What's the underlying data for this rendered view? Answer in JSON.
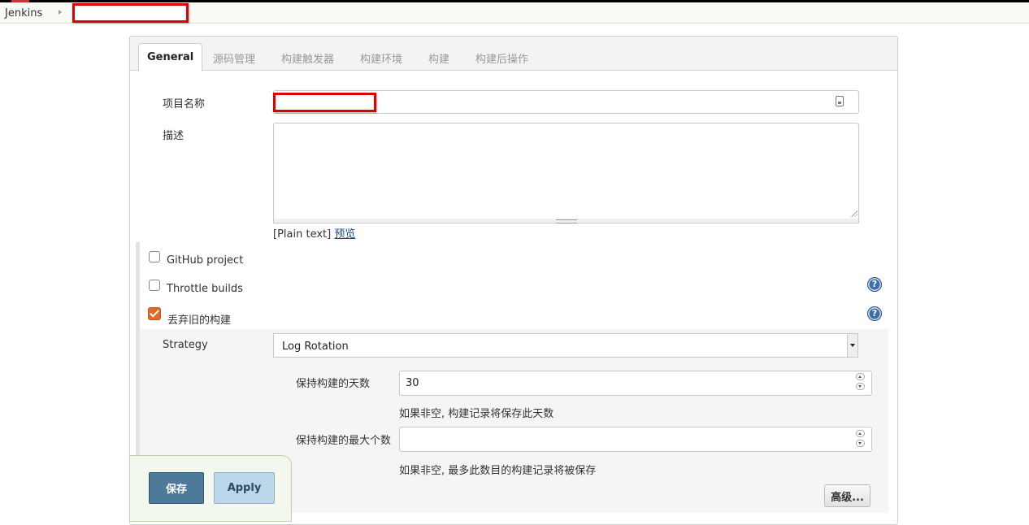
{
  "breadcrumb": {
    "root": "Jenkins"
  },
  "tabs": [
    {
      "label": "General",
      "active": true
    },
    {
      "label": "源码管理"
    },
    {
      "label": "构建触发器"
    },
    {
      "label": "构建环境"
    },
    {
      "label": "构建"
    },
    {
      "label": "构建后操作"
    }
  ],
  "general": {
    "project_name_label": "项目名称",
    "project_name_value": "",
    "description_label": "描述",
    "description_value": "",
    "plain_text_prefix": "[Plain text]",
    "preview_link": "预览"
  },
  "options": [
    {
      "label": "GitHub project",
      "checked": false
    },
    {
      "label": "Throttle builds",
      "checked": false
    },
    {
      "label": "丢弃旧的构建",
      "checked": true
    }
  ],
  "strategy": {
    "label": "Strategy",
    "selected": "Log Rotation",
    "days_label": "保持构建的天数",
    "days_value": "30",
    "days_hint": "如果非空, 构建记录将保存此天数",
    "max_label": "保持构建的最大个数",
    "max_value": "",
    "max_hint": "如果非空, 最多此数目的构建记录将被保存",
    "advanced_button": "高级..."
  },
  "actions": {
    "save": "保存",
    "apply": "Apply"
  },
  "icons": {
    "help": "help-icon",
    "id_card": "id-card-icon",
    "checkmark": "checkmark-icon"
  },
  "colors": {
    "accent_checked": "#e06a2c",
    "save_button": "#4c7a98",
    "redaction": "#e00000"
  }
}
